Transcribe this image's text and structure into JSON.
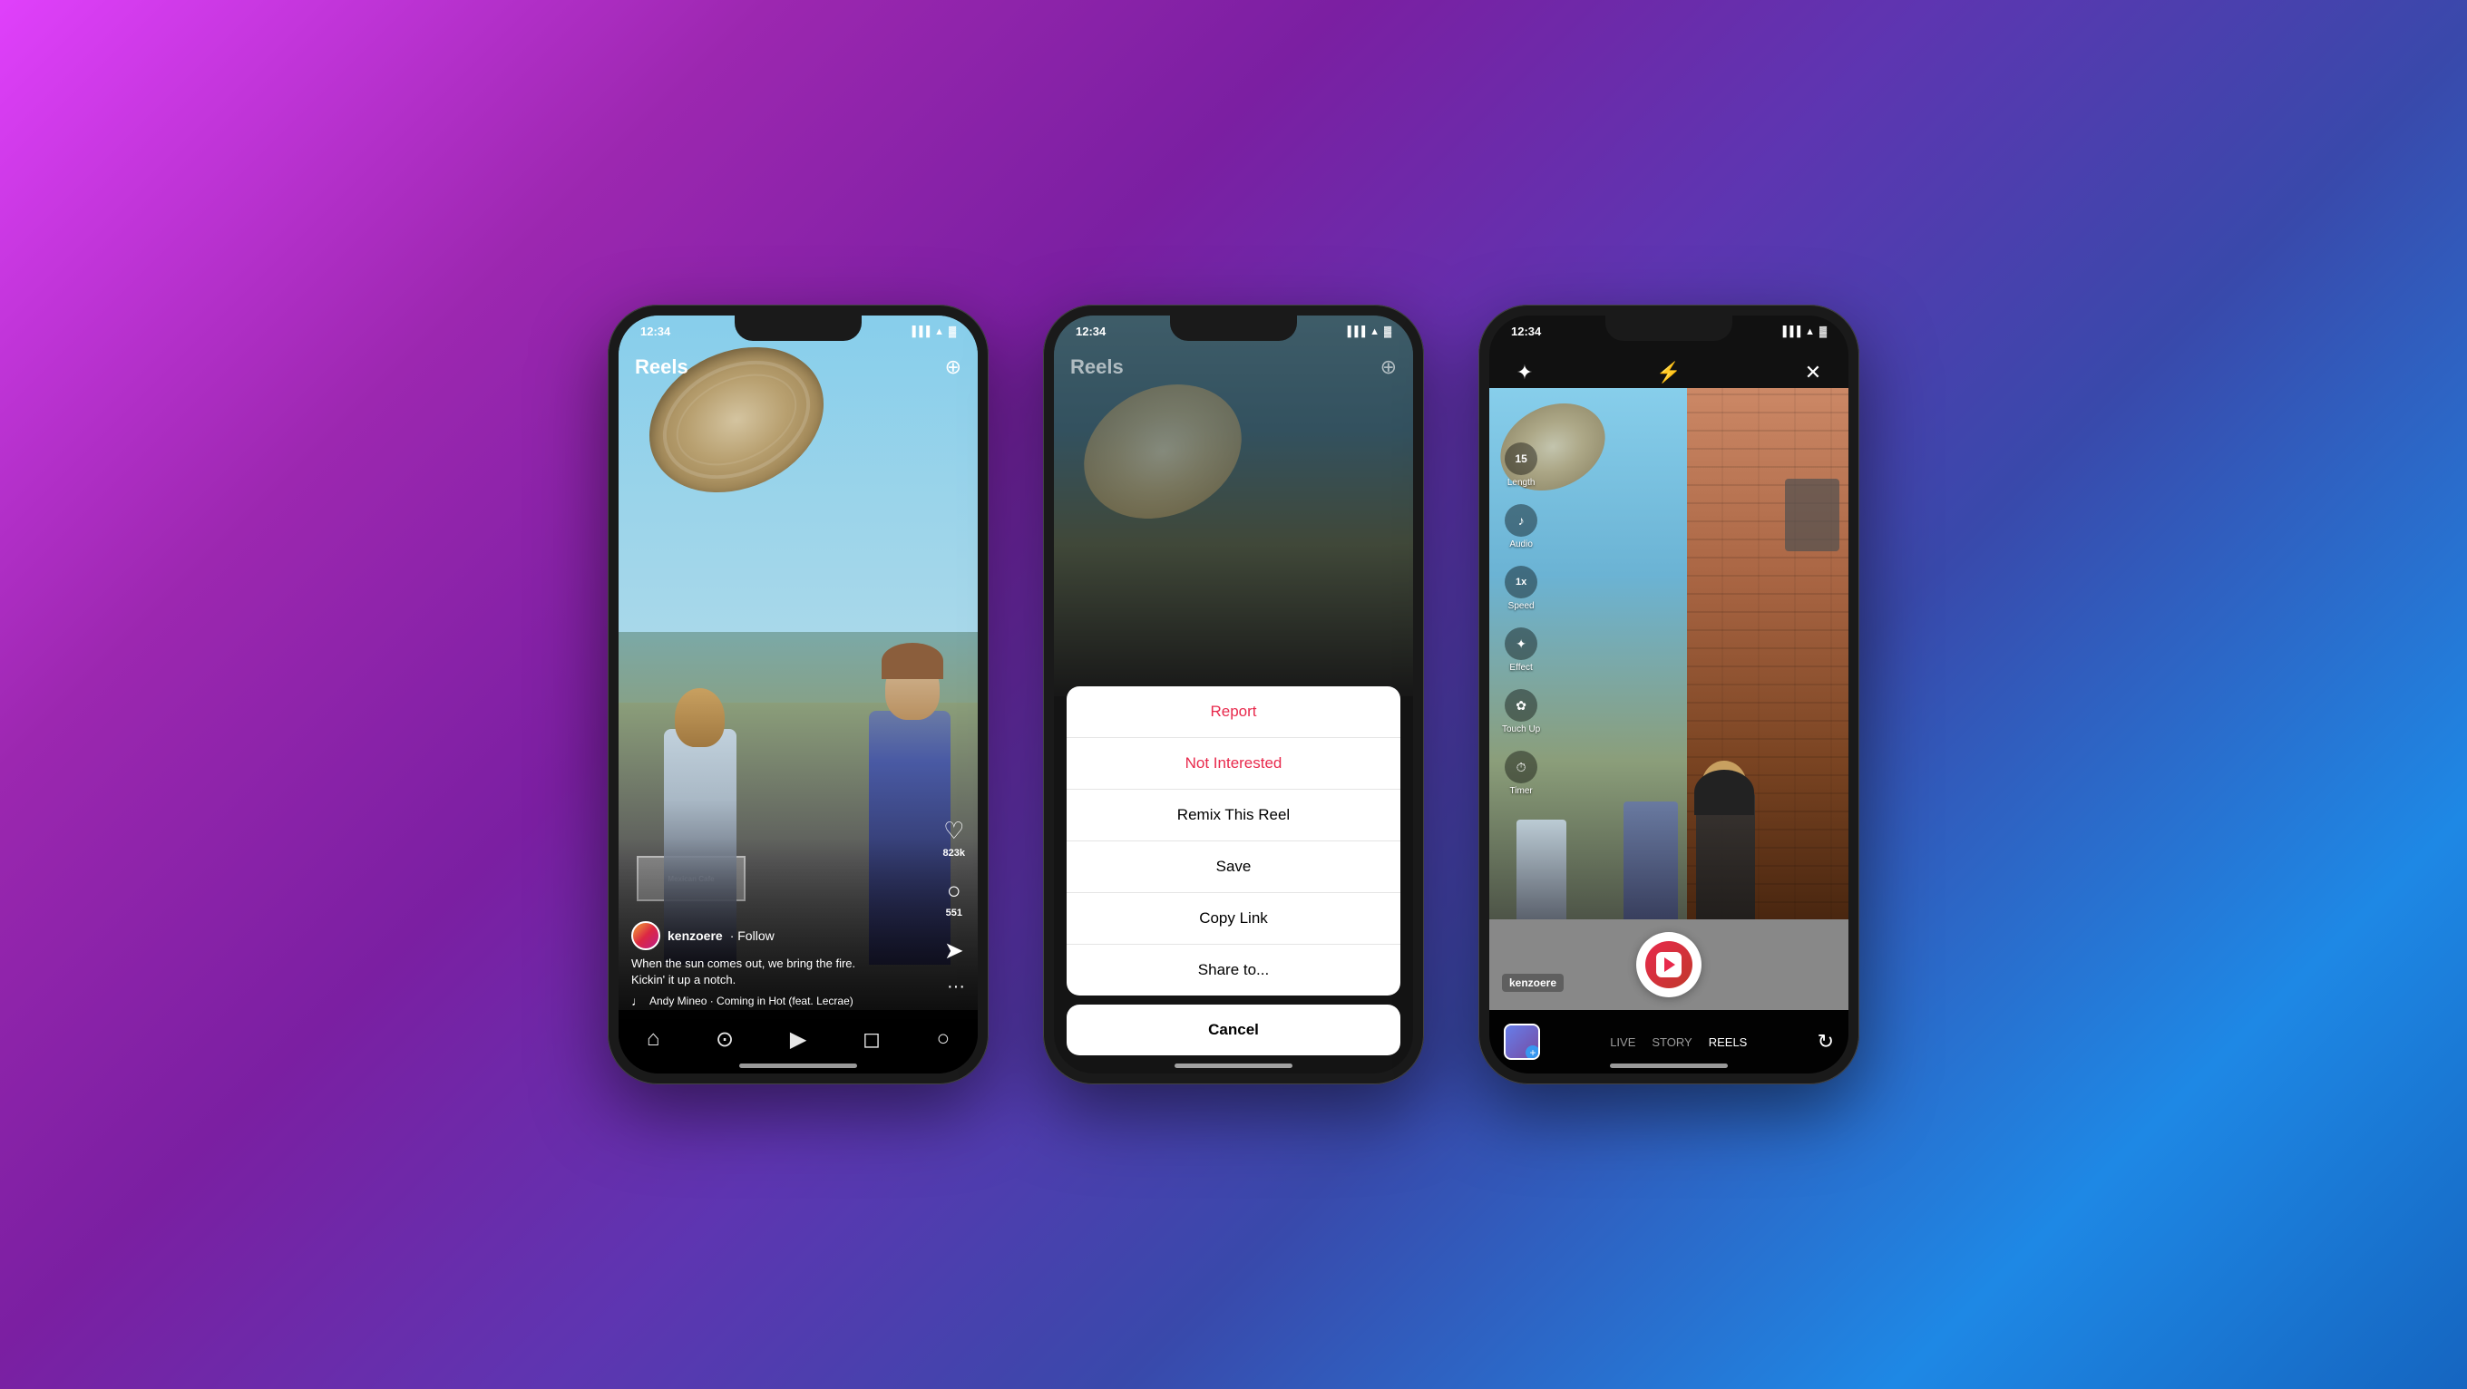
{
  "background": {
    "gradient": "linear-gradient(135deg, #e040fb 0%, #9c27b0 20%, #7b1fa2 35%, #5e35b1 50%, #3949ab 65%, #1e88e5 85%, #1565c0 100%)"
  },
  "phone1": {
    "status_time": "12:34",
    "header_title": "Reels",
    "username": "kenzoere",
    "follow": "· Follow",
    "caption_line1": "When the sun comes out, we bring the fire.",
    "caption_line2": "Kickin' it up a notch.",
    "audio": "Andy Mineo · Coming in Hot (feat. Lecrae)",
    "likes": "823k",
    "comments": "551",
    "nav_items": [
      "home",
      "search",
      "reels",
      "shop",
      "profile"
    ]
  },
  "phone2": {
    "status_time": "12:34",
    "header_title": "Reels",
    "menu": {
      "items": [
        {
          "label": "Report",
          "style": "red"
        },
        {
          "label": "Not Interested",
          "style": "red"
        },
        {
          "label": "Remix This Reel",
          "style": "normal"
        },
        {
          "label": "Save",
          "style": "normal"
        },
        {
          "label": "Copy Link",
          "style": "normal"
        },
        {
          "label": "Share to...",
          "style": "normal"
        }
      ],
      "cancel": "Cancel"
    }
  },
  "phone3": {
    "status_time": "12:34",
    "tools": [
      {
        "label": "Length",
        "value": "15"
      },
      {
        "label": "Audio",
        "icon": "♪"
      },
      {
        "label": "Speed",
        "value": "1x"
      },
      {
        "label": "Effect",
        "icon": "✦"
      },
      {
        "label": "Touch Up",
        "icon": "✿"
      },
      {
        "label": "Timer",
        "icon": "⏱"
      }
    ],
    "creator_label": "kenzoere",
    "modes": {
      "live": "LIVE",
      "story": "STORY",
      "reels": "REELS"
    },
    "mode_active": "REELS"
  }
}
